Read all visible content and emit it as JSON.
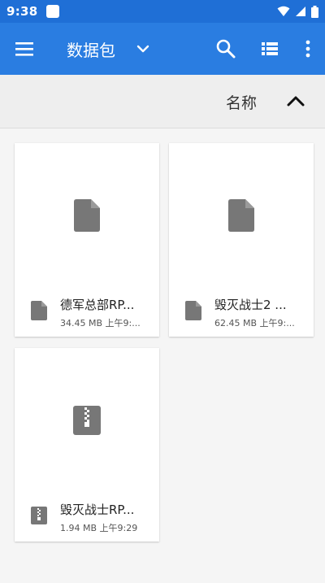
{
  "status_bar": {
    "time": "9:38",
    "icons": [
      "notification-square-icon",
      "wifi-icon",
      "signal-icon",
      "battery-icon"
    ]
  },
  "app_bar": {
    "title": "数据包",
    "icons": [
      "menu-icon",
      "chevron-down-icon",
      "search-icon",
      "view-list-icon",
      "more-vert-icon"
    ],
    "color": "#2a7de1"
  },
  "sort": {
    "label": "名称",
    "direction_icon": "chevron-up-icon"
  },
  "files": [
    {
      "name": "德军总部RP...",
      "meta": "34.45 MB 上午9:...",
      "icon": "file-icon"
    },
    {
      "name": "毁灭战士2 ...",
      "meta": "62.45 MB 上午9:...",
      "icon": "file-icon"
    },
    {
      "name": "毁灭战士RP...",
      "meta": "1.94 MB 上午9:29",
      "icon": "zip-file-icon"
    }
  ]
}
